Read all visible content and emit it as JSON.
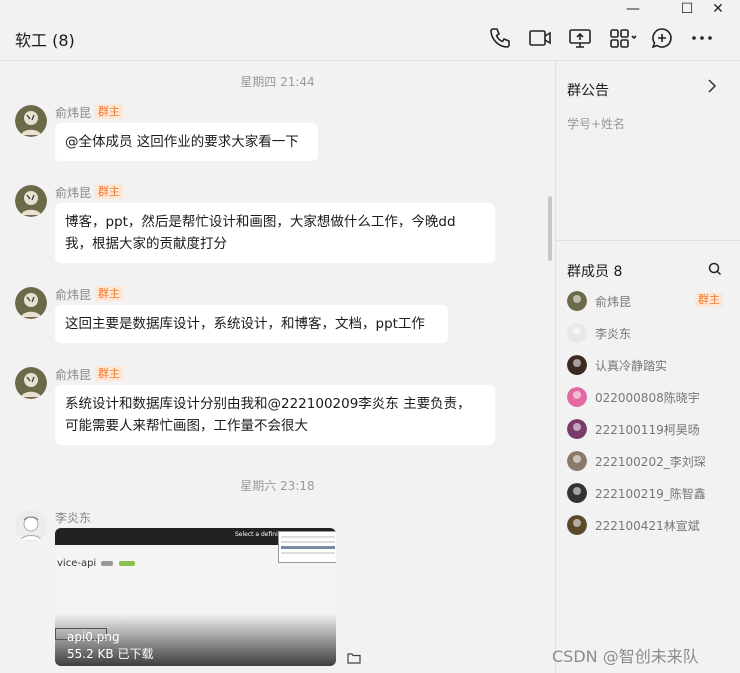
{
  "window": {
    "title": "软工 (8)",
    "controls": {
      "minimize": "—",
      "maximize": "☐",
      "close": "✕"
    }
  },
  "toolbar": {
    "icons": [
      "phone-icon",
      "video-call-icon",
      "screen-share-icon",
      "apps-grid-icon",
      "add-chat-icon",
      "more-icon"
    ]
  },
  "chat": {
    "messages_1": {
      "timestamp": "星期四 21:44",
      "m1": {
        "sender": "俞炜昆",
        "badge": "群主",
        "text": "@全体成员 这回作业的要求大家看一下"
      },
      "m2": {
        "sender": "俞炜昆",
        "badge": "群主",
        "line1": "博客，ppt，然后是帮忙设计和画图，大家想做什么工作，今晚dd",
        "line2": "我，根据大家的贡献度打分"
      },
      "m3": {
        "sender": "俞炜昆",
        "badge": "群主",
        "text": "这回主要是数据库设计，系统设计，和博客，文档，ppt工作"
      },
      "m4": {
        "sender": "俞炜昆",
        "badge": "群主",
        "line1": "系统设计和数据库设计分别由我和@222100209李炎东 主要负责，",
        "line2": "可能需要人来帮忙画图，工作量不会很大"
      }
    },
    "messages_2": {
      "timestamp": "星期六 23:18",
      "m5": {
        "sender": "李炎东",
        "image": {
          "file_name": "api0.png",
          "file_info": "55.2 KB 已下载",
          "preview_heading": "vice-api",
          "preview_topbar_text": "Select a definition"
        }
      }
    }
  },
  "sidebar": {
    "notice": {
      "title": "群公告",
      "text": "学号+姓名"
    },
    "members": {
      "title": "群成员 8",
      "list": [
        {
          "name": "俞炜昆",
          "badge": "群主",
          "color": "#6b6b4a"
        },
        {
          "name": "李炎东",
          "color": "#e8e8e8"
        },
        {
          "name": "认真冷静踏实",
          "color": "#3a2a22"
        },
        {
          "name": "022000808陈晓宇",
          "color": "#e26aa0"
        },
        {
          "name": "222100119柯昊旸",
          "color": "#7a3a6a"
        },
        {
          "name": "222100202_李刘琛",
          "color": "#8a7a6a"
        },
        {
          "name": "222100219_陈智鑫",
          "color": "#333333"
        },
        {
          "name": "222100421林宣斌",
          "color": "#5a4a2a"
        }
      ]
    }
  },
  "watermark": "CSDN @智创未来队",
  "colors": {
    "badge_text": "#f07a2f",
    "badge_bg": "#fde7d6",
    "bubble": "#ffffff",
    "background": "#f2f2f2"
  }
}
